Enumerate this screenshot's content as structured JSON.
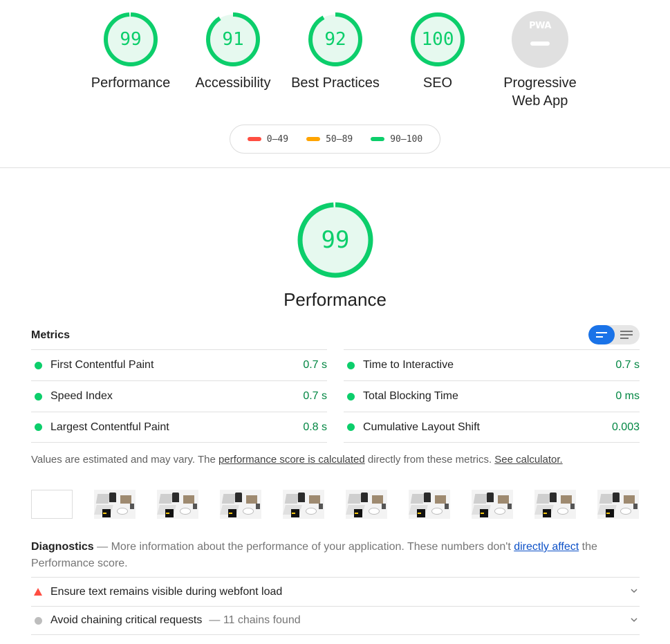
{
  "categories": [
    {
      "id": "performance",
      "score": "99",
      "label": "Performance",
      "fraction": 0.99
    },
    {
      "id": "accessibility",
      "score": "91",
      "label": "Accessibility",
      "fraction": 0.91
    },
    {
      "id": "best-practices",
      "score": "92",
      "label": "Best Practices",
      "fraction": 0.92
    },
    {
      "id": "seo",
      "score": "100",
      "label": "SEO",
      "fraction": 1.0
    }
  ],
  "pwa": {
    "badge_text": "PWA",
    "label_line1": "Progressive",
    "label_line2": "Web App"
  },
  "legend": [
    {
      "range": "0–49",
      "color": "#ff4e42"
    },
    {
      "range": "50–89",
      "color": "#ffa400"
    },
    {
      "range": "90–100",
      "color": "#0cce6b"
    }
  ],
  "performance": {
    "score": "99",
    "fraction": 0.99,
    "title": "Performance",
    "metrics_heading": "Metrics",
    "metrics_left": [
      {
        "name": "First Contentful Paint",
        "value": "0.7 s"
      },
      {
        "name": "Speed Index",
        "value": "0.7 s"
      },
      {
        "name": "Largest Contentful Paint",
        "value": "0.8 s"
      }
    ],
    "metrics_right": [
      {
        "name": "Time to Interactive",
        "value": "0.7 s"
      },
      {
        "name": "Total Blocking Time",
        "value": "0 ms"
      },
      {
        "name": "Cumulative Layout Shift",
        "value": "0.003"
      }
    ],
    "note_prefix": "Values are estimated and may vary. The ",
    "note_link1": "performance score is calculated",
    "note_middle": " directly from these metrics. ",
    "note_link2": "See calculator."
  },
  "diagnostics": {
    "heading": "Diagnostics",
    "text_before": " — More information about the performance of your application. These numbers don't ",
    "link": "directly affect",
    "text_after": " the Performance score.",
    "audits": [
      {
        "title": "Ensure text remains visible during webfont load",
        "extra": "",
        "status": "fail"
      },
      {
        "title": "Avoid chaining critical requests",
        "extra": "— 11 chains found",
        "status": "info"
      }
    ]
  },
  "colors": {
    "pass": "#0cce6b",
    "pass_fill": "#e6f9ef",
    "fail": "#ff4e42",
    "average": "#ffa400"
  }
}
